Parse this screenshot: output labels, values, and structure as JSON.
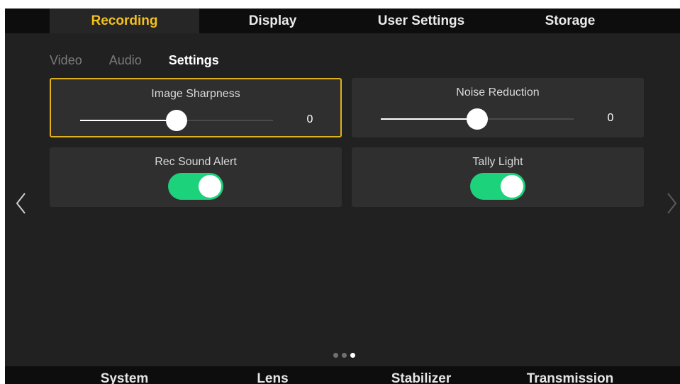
{
  "top_tabs": [
    {
      "label": "Recording",
      "active": true
    },
    {
      "label": "Display"
    },
    {
      "label": "User Settings"
    },
    {
      "label": "Storage"
    }
  ],
  "sub_tabs": [
    {
      "label": "Video"
    },
    {
      "label": "Audio"
    },
    {
      "label": "Settings",
      "active": true
    }
  ],
  "cards": {
    "image_sharpness": {
      "label": "Image Sharpness",
      "value": "0",
      "slider_fraction": 0.5
    },
    "noise_reduction": {
      "label": "Noise Reduction",
      "value": "0",
      "slider_fraction": 0.5
    },
    "rec_sound_alert": {
      "label": "Rec Sound Alert",
      "on": true
    },
    "tally_light": {
      "label": "Tally Light",
      "on": true
    }
  },
  "pagination": {
    "pages": 3,
    "current": 3
  },
  "bottom_tabs": [
    {
      "label": "System"
    },
    {
      "label": "Lens"
    },
    {
      "label": "Stabilizer"
    },
    {
      "label": "Transmission"
    }
  ],
  "colors": {
    "accent": "#f3c21c",
    "toggle_on": "#1cd27a",
    "background": "#212121",
    "card": "#2f2f2f"
  },
  "icons": [
    "chevron-left-icon",
    "chevron-right-icon"
  ]
}
